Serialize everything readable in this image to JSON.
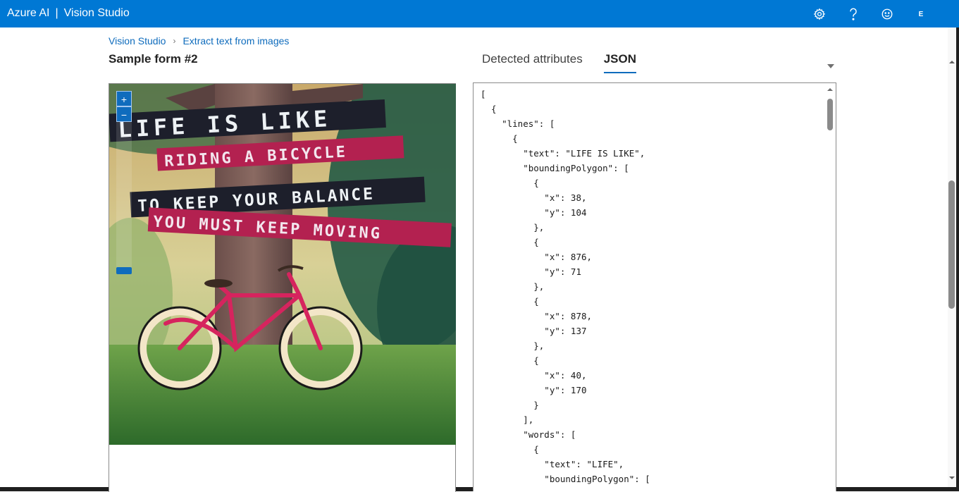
{
  "topbar": {
    "brand": "Azure AI",
    "separator": "|",
    "product": "Vision Studio",
    "avatar_initial": "E",
    "icons": [
      "gear-icon",
      "help-icon",
      "feedback-smiley-icon",
      "account-icon"
    ]
  },
  "breadcrumb": {
    "items": [
      "Vision Studio",
      "Extract text from images"
    ]
  },
  "page": {
    "title": "Sample form #2"
  },
  "tabs": {
    "items": [
      "Detected attributes",
      "JSON"
    ],
    "active": "JSON"
  },
  "photo": {
    "lines": [
      "LIFE IS LIKE",
      "RIDING A BICYCLE",
      "TO KEEP YOUR BALANCE",
      "YOU MUST KEEP MOVING"
    ]
  },
  "zoom": {
    "in": "+",
    "out": "−"
  },
  "json_view": {
    "lines": [
      "[",
      "  {",
      "    \"lines\": [",
      "      {",
      "        \"text\": \"LIFE IS LIKE\",",
      "        \"boundingPolygon\": [",
      "          {",
      "            \"x\": 38,",
      "            \"y\": 104",
      "          },",
      "          {",
      "            \"x\": 876,",
      "            \"y\": 71",
      "          },",
      "          {",
      "            \"x\": 878,",
      "            \"y\": 137",
      "          },",
      "          {",
      "            \"x\": 40,",
      "            \"y\": 170",
      "          }",
      "        ],",
      "        \"words\": [",
      "          {",
      "            \"text\": \"LIFE\",",
      "            \"boundingPolygon\": ["
    ]
  },
  "colors": {
    "accent": "#0078d4",
    "link": "#0f6cbd"
  }
}
